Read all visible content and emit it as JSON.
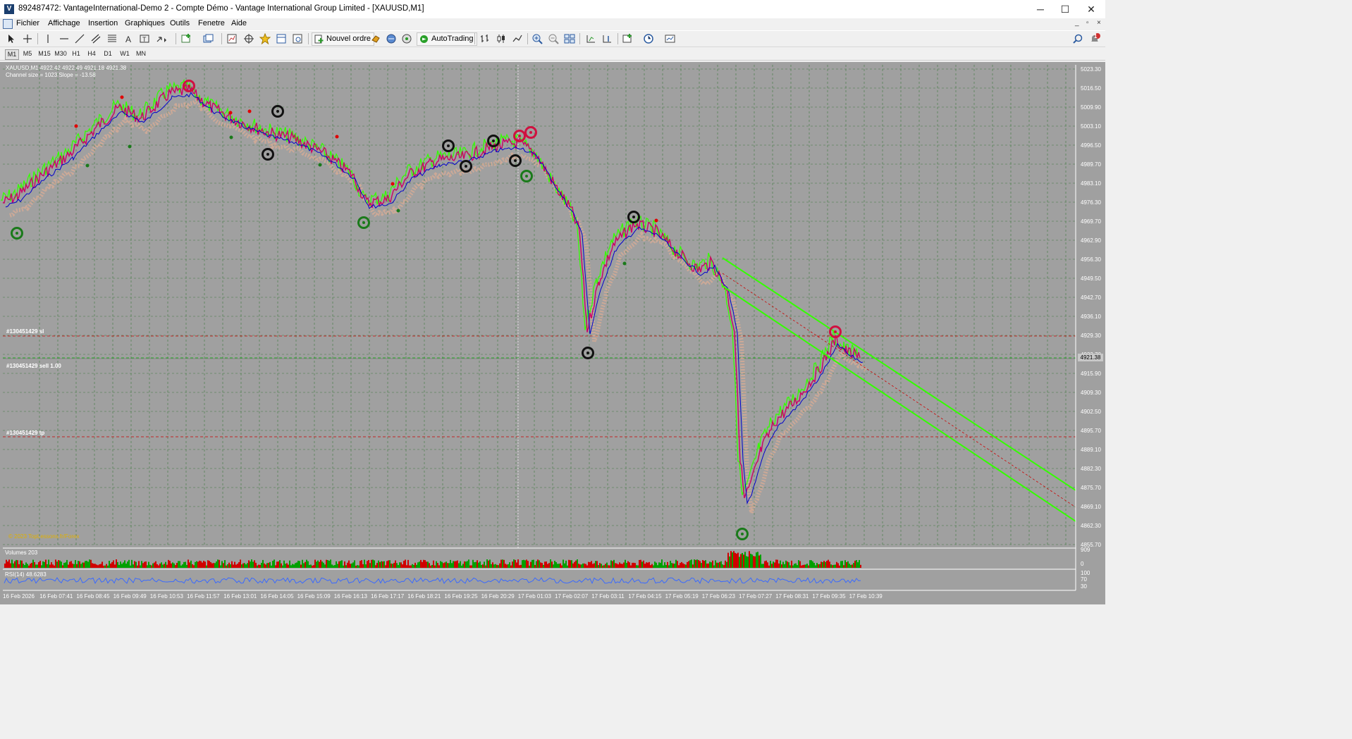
{
  "window": {
    "title": "892487472: VantageInternational-Demo 2 - Compte Démo - Vantage International Group Limited - [XAUUSD,M1]",
    "minimize": "─",
    "maximize": "☐",
    "close": "✕"
  },
  "menu": {
    "items": [
      "Fichier",
      "Affichage",
      "Insertion",
      "Graphiques",
      "Outils",
      "Fenetre",
      "Aide"
    ],
    "mdi_min": "_",
    "mdi_restore": "▫",
    "mdi_close": "×"
  },
  "toolbar": {
    "new_order": "Nouvel ordre",
    "autotrading": "AutoTrading",
    "notification_count": "1"
  },
  "timeframes": [
    "M1",
    "M5",
    "M15",
    "M30",
    "H1",
    "H4",
    "D1",
    "W1",
    "MN"
  ],
  "timeframe_selected": "M1",
  "chart": {
    "ohlc_header": "XAUUSD,M1  4922.42 4922.49 4921.18 4921.38",
    "channel_info": "Channel size = 1023 Slope = -13.58",
    "current_price": "4921.38",
    "orders": {
      "sl": "#130451429 sl",
      "entry": "#130451429 sell 1.00",
      "tp": "#130451429 tp"
    },
    "copyright": "© 2023 TopLessons.fr/Forex",
    "volumes_label": "Volumes 203",
    "rsi_label": "RSI(14) 48.6283",
    "volume_scale": [
      "909",
      "0"
    ],
    "rsi_scale": [
      "100",
      "70",
      "30"
    ],
    "price_ticks": [
      "5023.30",
      "5016.50",
      "5009.90",
      "5003.10",
      "4996.50",
      "4989.70",
      "4983.10",
      "4976.30",
      "4969.70",
      "4962.90",
      "4956.30",
      "4949.50",
      "4942.70",
      "4936.10",
      "4929.30",
      "4922.70",
      "4915.90",
      "4909.30",
      "4902.50",
      "4895.70",
      "4889.10",
      "4882.30",
      "4875.70",
      "4869.10",
      "4862.30",
      "4855.70"
    ],
    "time_ticks": [
      "16 Feb 2026",
      "16 Feb 07:41",
      "16 Feb 08:45",
      "16 Feb 09:49",
      "16 Feb 10:53",
      "16 Feb 11:57",
      "16 Feb 13:01",
      "16 Feb 14:05",
      "16 Feb 15:09",
      "16 Feb 16:13",
      "16 Feb 17:17",
      "16 Feb 18:21",
      "16 Feb 19:25",
      "16 Feb 20:29",
      "17 Feb 01:03",
      "17 Feb 02:07",
      "17 Feb 03:11",
      "17 Feb 04:15",
      "17 Feb 05:19",
      "17 Feb 06:23",
      "17 Feb 07:27",
      "17 Feb 08:31",
      "17 Feb 09:35",
      "17 Feb 10:39"
    ],
    "colors": {
      "background": "#a0a0a0",
      "grid": "#3f7a3f",
      "price_line": "#0000cc",
      "candles": "#cc0066",
      "ma_green": "#33ff00",
      "cloud": "#f0a070",
      "sl_line": "#cc0000",
      "tp_line": "#cc0000",
      "entry_line": "#00cc00",
      "volume_up": "#00a000",
      "volume_down": "#d00000",
      "rsi": "#3366ff"
    }
  }
}
